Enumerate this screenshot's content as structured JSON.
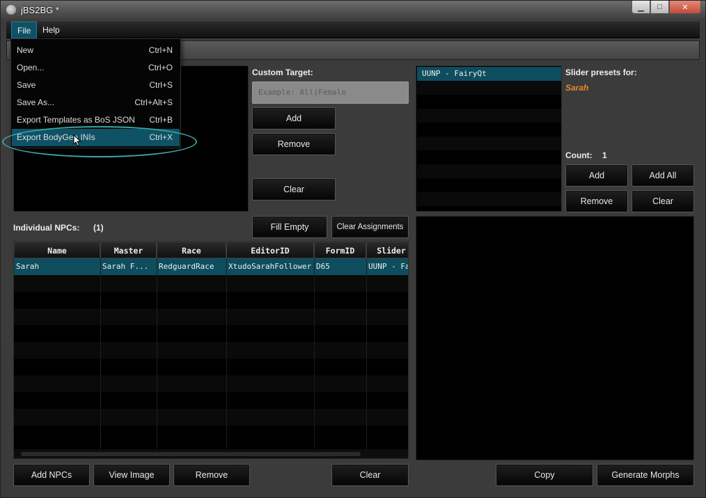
{
  "window": {
    "title": "jBS2BG *",
    "min_glyph": "▁",
    "max_glyph": "□",
    "close_glyph": "✕"
  },
  "menubar": {
    "items": [
      {
        "label": "File"
      },
      {
        "label": "Help"
      }
    ]
  },
  "file_menu": {
    "items": [
      {
        "label": "New",
        "shortcut": "Ctrl+N"
      },
      {
        "label": "Open...",
        "shortcut": "Ctrl+O"
      },
      {
        "label": "Save",
        "shortcut": "Ctrl+S"
      },
      {
        "label": "Save As...",
        "shortcut": "Ctrl+Alt+S"
      },
      {
        "label": "Export Templates as BoS JSON",
        "shortcut": "Ctrl+B"
      },
      {
        "label": "Export BodyGen INIs",
        "shortcut": "Ctrl+X"
      }
    ],
    "highlighted_index": 5
  },
  "custom_target": {
    "label": "Custom Target:",
    "placeholder": "Example: All|Female",
    "add_label": "Add",
    "remove_label": "Remove",
    "clear_label": "Clear"
  },
  "individual_npcs": {
    "label": "Individual NPCs:",
    "count": "(1)",
    "fill_empty_label": "Fill Empty",
    "clear_assignments_label": "Clear Assignments",
    "columns": [
      "Name",
      "Master",
      "Race",
      "EditorID",
      "FormID",
      "Slider"
    ],
    "rows": [
      [
        "Sarah",
        "Sarah F...",
        "RedguardRace",
        "XtudoSarahFollower",
        "D65",
        "UUNP - Fa"
      ]
    ]
  },
  "presets": {
    "list": [
      "UUNP - FairyQt"
    ],
    "for_label": "Slider presets for:",
    "for_value": "Sarah",
    "count_label": "Count:",
    "count_value": "1",
    "add_label": "Add",
    "add_all_label": "Add All",
    "remove_label": "Remove",
    "clear_label": "Clear"
  },
  "bottom_bar": {
    "add_npcs_label": "Add NPCs",
    "view_image_label": "View Image",
    "remove_label": "Remove",
    "clear_label": "Clear",
    "copy_label": "Copy",
    "generate_morphs_label": "Generate Morphs"
  },
  "colors": {
    "accent": "#0f5265",
    "highlight_name": "#e8892c",
    "annotation": "#3aa5a3"
  }
}
